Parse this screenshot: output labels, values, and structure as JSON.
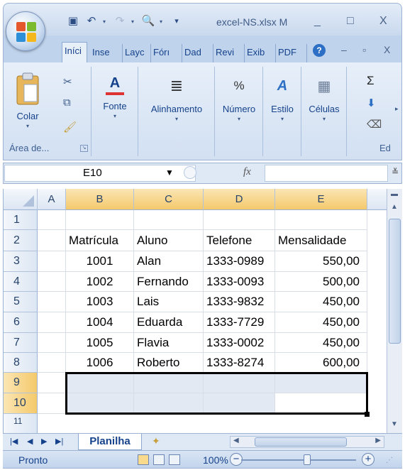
{
  "window": {
    "title": "excel-NS.xlsx  M",
    "minimize": "_",
    "maximize": "□",
    "close": "X"
  },
  "ribbon_tabs": [
    "Iníci",
    "Inse",
    "Layc",
    "Fórı",
    "Dad",
    "Revi",
    "Exib",
    "PDF"
  ],
  "ribbon_tab_controls": {
    "help": "?",
    "minimize": "–",
    "restore": "▫",
    "close": "X"
  },
  "ribbon_groups": {
    "clipboard": {
      "paste_label": "Colar",
      "group_label": "Área de..."
    },
    "font": {
      "label": "Fonte"
    },
    "alignment": {
      "label": "Alinhamento"
    },
    "number": {
      "label": "Número"
    },
    "style": {
      "label": "Estilo"
    },
    "cells": {
      "label": "Células"
    },
    "editing": {
      "label": "Ed"
    }
  },
  "formula_bar": {
    "name_box": "E10",
    "fx_symbol": "fx",
    "formula": ""
  },
  "sheet": {
    "columns": [
      "A",
      "B",
      "C",
      "D",
      "E"
    ],
    "rows": [
      "1",
      "2",
      "3",
      "4",
      "5",
      "6",
      "7",
      "8",
      "9",
      "10",
      "11"
    ],
    "cells": {
      "header": {
        "B": "Matrícula",
        "C": "Aluno",
        "D": "Telefone",
        "E": "Mensalidade"
      },
      "data": [
        {
          "B": "1001",
          "C": "Alan",
          "D": "1333-0989",
          "E": "550,00"
        },
        {
          "B": "1002",
          "C": "Fernando",
          "D": "1333-0093",
          "E": "500,00"
        },
        {
          "B": "1003",
          "C": "Lais",
          "D": "1333-9832",
          "E": "450,00"
        },
        {
          "B": "1004",
          "C": "Eduarda",
          "D": "1333-7729",
          "E": "450,00"
        },
        {
          "B": "1005",
          "C": "Flavia",
          "D": "1333-0002",
          "E": "450,00"
        },
        {
          "B": "1006",
          "C": "Roberto",
          "D": "1333-8274",
          "E": "600,00"
        }
      ]
    },
    "selected_range": "B9:E10",
    "active_cell": "E10"
  },
  "sheet_tabs": {
    "active": "Planilha"
  },
  "status_bar": {
    "status": "Pronto",
    "zoom": "100%"
  },
  "colors": {
    "ribbon_text": "#15428b",
    "selection_header": "#f4c96b",
    "selection_fill": "#e3e9f3"
  }
}
